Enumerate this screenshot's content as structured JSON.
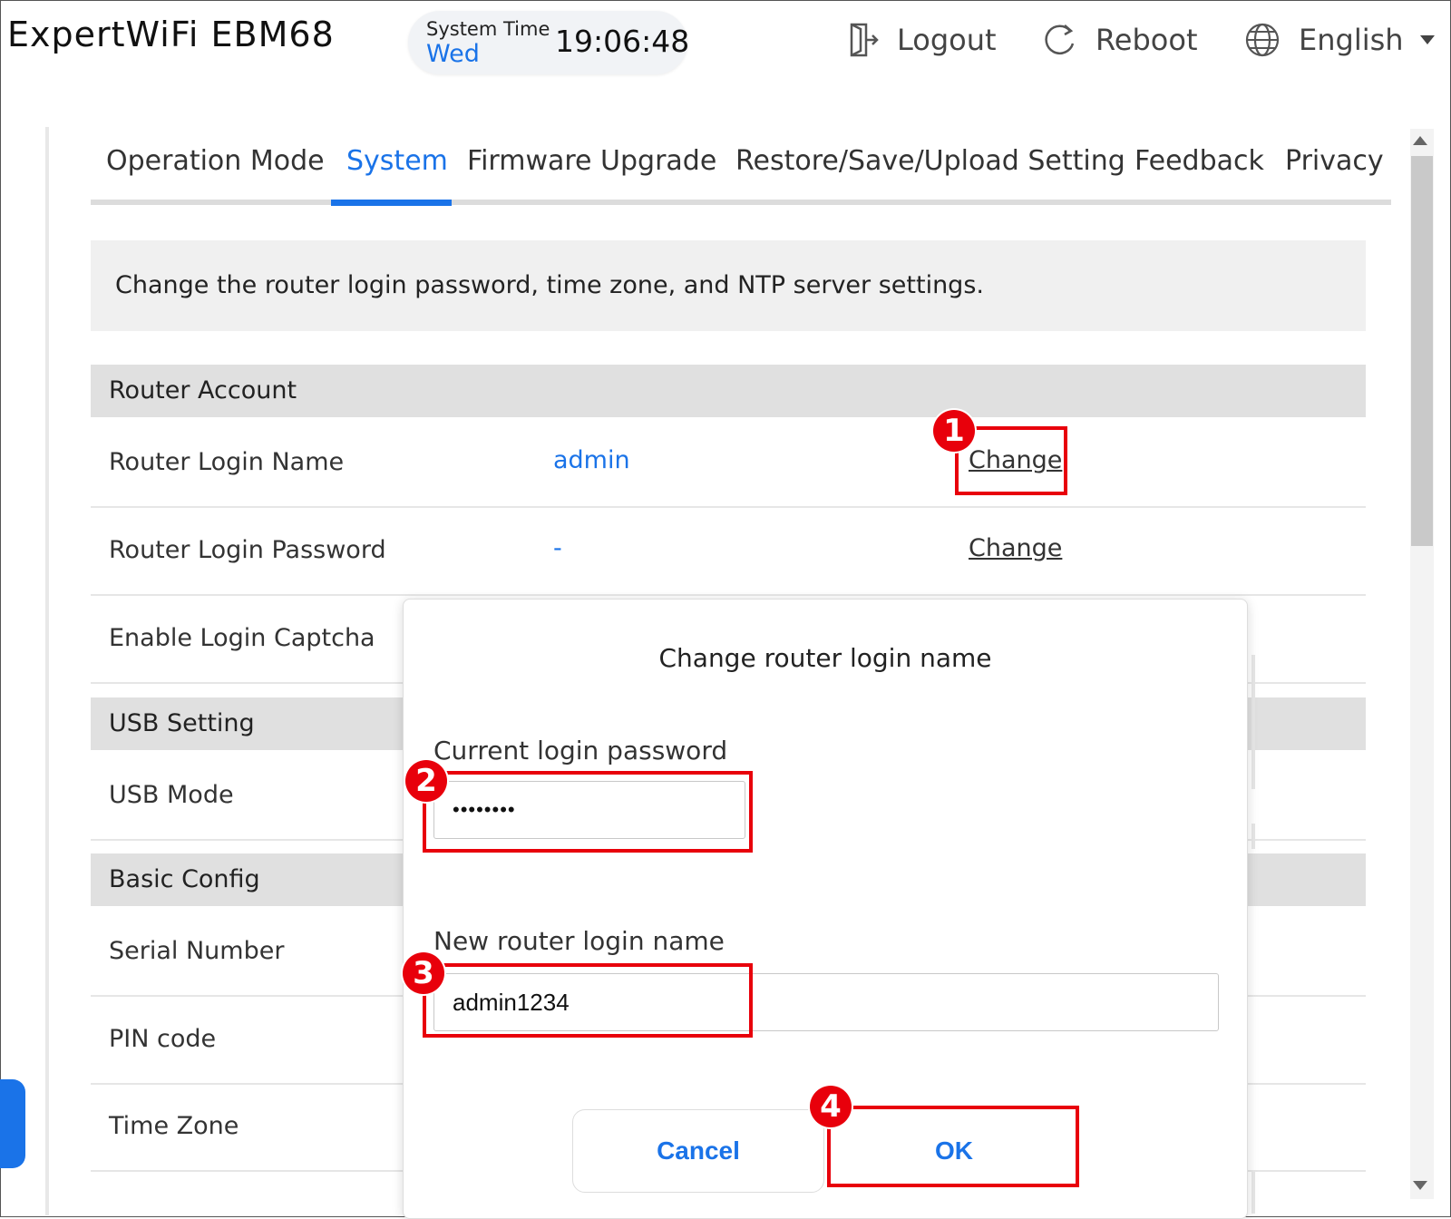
{
  "header": {
    "brand": "ExpertWiFi EBM68",
    "system_time_label": "System Time",
    "day": "Wed",
    "clock": "19:06:48",
    "logout_label": "Logout",
    "reboot_label": "Reboot",
    "language_label": "English"
  },
  "tabs": [
    {
      "label": "Operation Mode"
    },
    {
      "label": "System",
      "active": true
    },
    {
      "label": "Firmware Upgrade"
    },
    {
      "label": "Restore/Save/Upload Setting"
    },
    {
      "label": "Feedback"
    },
    {
      "label": "Privacy"
    }
  ],
  "description": "Change the router login password, time zone, and NTP server settings.",
  "sections": {
    "router_account": "Router Account",
    "usb_setting": "USB Setting",
    "basic_config": "Basic Config"
  },
  "rows": {
    "login_name": {
      "label": "Router Login Name",
      "value": "admin",
      "action": "Change"
    },
    "login_password": {
      "label": "Router Login Password",
      "value": "-",
      "action": "Change"
    },
    "login_captcha": {
      "label": "Enable Login Captcha"
    },
    "usb_mode": {
      "label": "USB Mode"
    },
    "serial_number": {
      "label": "Serial Number"
    },
    "pin_code": {
      "label": "PIN code"
    },
    "time_zone": {
      "label": "Time Zone"
    }
  },
  "modal": {
    "title": "Change router login name",
    "current_password_label": "Current login password",
    "current_password_value": "••••••••",
    "new_name_label": "New router login name",
    "new_name_value": "admin1234",
    "cancel_label": "Cancel",
    "ok_label": "OK"
  },
  "annotations": [
    "1",
    "2",
    "3",
    "4"
  ],
  "colors": {
    "accent": "#1a73e8",
    "highlight": "#e8000b"
  }
}
